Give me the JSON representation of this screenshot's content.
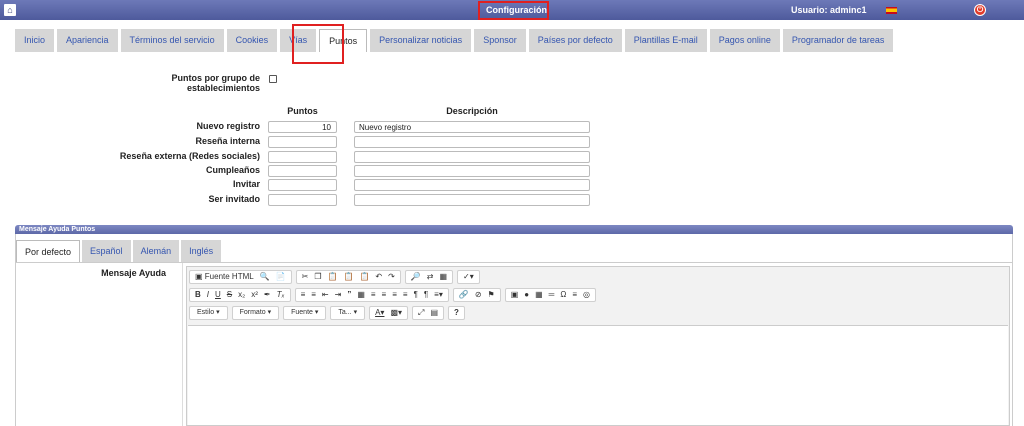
{
  "header": {
    "title": "Configuración",
    "user": "Usuario: adminc1"
  },
  "tabs": [
    {
      "label": "Inicio"
    },
    {
      "label": "Apariencia"
    },
    {
      "label": "Términos del servicio"
    },
    {
      "label": "Cookies"
    },
    {
      "label": "Vías"
    },
    {
      "label": "Puntos",
      "active": true
    },
    {
      "label": "Personalizar noticias"
    },
    {
      "label": "Sponsor"
    },
    {
      "label": "Países por defecto"
    },
    {
      "label": "Plantillas E-mail"
    },
    {
      "label": "Pagos online"
    },
    {
      "label": "Programador de tareas"
    }
  ],
  "form": {
    "group_label": "Puntos por grupo de establecimientos",
    "col_puntos": "Puntos",
    "col_desc": "Descripción",
    "rows": [
      {
        "label": "Nuevo registro",
        "points": "10",
        "desc": "Nuevo registro"
      },
      {
        "label": "Reseña interna",
        "points": "",
        "desc": ""
      },
      {
        "label": "Reseña externa (Redes sociales)",
        "points": "",
        "desc": ""
      },
      {
        "label": "Cumpleaños",
        "points": "",
        "desc": ""
      },
      {
        "label": "Invitar",
        "points": "",
        "desc": ""
      },
      {
        "label": "Ser invitado",
        "points": "",
        "desc": ""
      }
    ]
  },
  "panel": {
    "title": "Mensaje Ayuda Puntos",
    "subtabs": [
      {
        "label": "Por defecto",
        "active": true
      },
      {
        "label": "Español"
      },
      {
        "label": "Alemán"
      },
      {
        "label": "Inglés"
      }
    ],
    "message_label": "Mensaje Ayuda"
  },
  "editor": {
    "source_label": "Fuente HTML",
    "dropdowns": [
      "Estilo",
      "Formato",
      "Fuente",
      "Ta..."
    ],
    "help": "?"
  },
  "colors": {
    "topbar": "#5a66a8",
    "highlight": "#e02020",
    "tab_bg": "#d6d6d6",
    "link": "#3556b0"
  }
}
